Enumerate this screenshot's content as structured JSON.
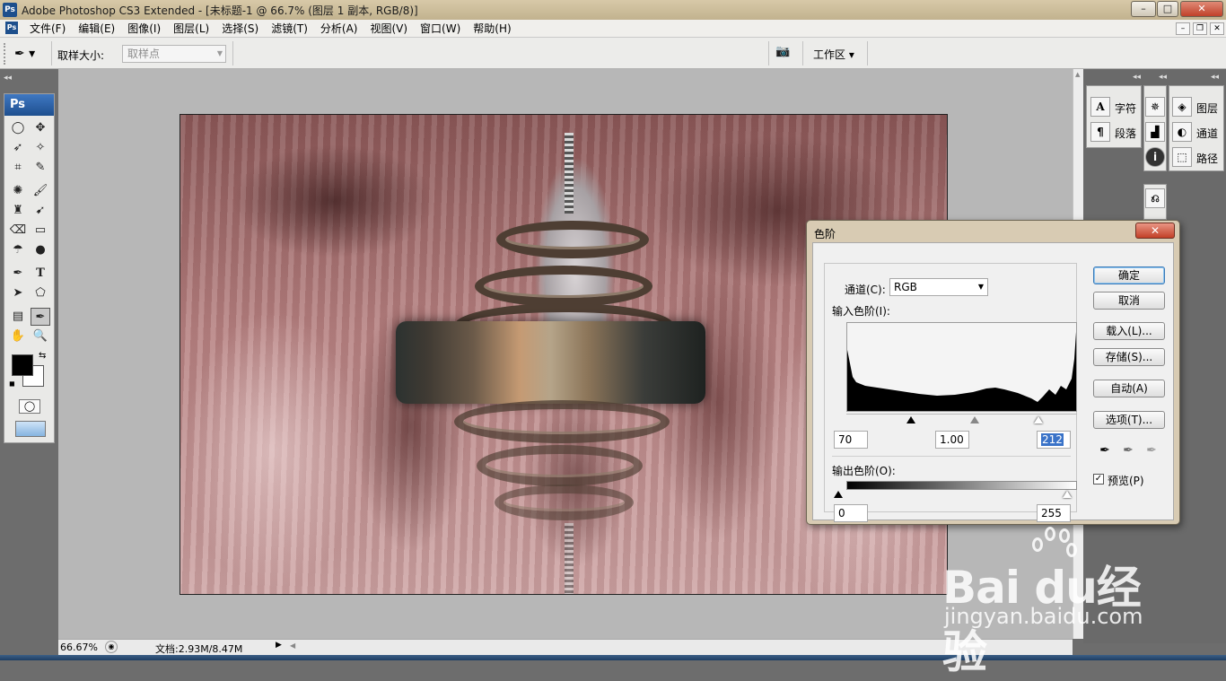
{
  "window": {
    "title": "Adobe Photoshop CS3 Extended - [未标题-1 @ 66.7% (图层 1 副本, RGB/8)]",
    "app_icon": "Ps",
    "minimize": "–",
    "maximize": "□",
    "close": "✕"
  },
  "menu": {
    "items": [
      "文件(F)",
      "编辑(E)",
      "图像(I)",
      "图层(L)",
      "选择(S)",
      "滤镜(T)",
      "分析(A)",
      "视图(V)",
      "窗口(W)",
      "帮助(H)"
    ],
    "doc_minimize": "–",
    "doc_restore": "❐",
    "doc_close": "✕"
  },
  "options": {
    "sample_size_label": "取样大小:",
    "sample_size_value": "取样点",
    "workspace_label": "工作区 ▾"
  },
  "toolbox": {
    "header": "Ps"
  },
  "right_panels": {
    "group1": [
      {
        "icon": "A",
        "label": "字符"
      },
      {
        "icon": "¶",
        "label": "段落"
      }
    ],
    "group3": [
      {
        "icon": "◈",
        "label": "图层"
      },
      {
        "icon": "◐",
        "label": "通道"
      },
      {
        "icon": "⬚",
        "label": "路径"
      }
    ]
  },
  "status": {
    "zoom": "66.67%",
    "doc_info": "文档:2.93M/8.47M"
  },
  "levels": {
    "title": "色阶",
    "close": "✕",
    "channel_label": "通道(C):",
    "channel_value": "RGB",
    "input_label": "输入色阶(I):",
    "input_black": "70",
    "input_gamma": "1.00",
    "input_white": "212",
    "output_label": "输出色阶(O):",
    "output_black": "0",
    "output_white": "255",
    "buttons": {
      "ok": "确定",
      "cancel": "取消",
      "load": "载入(L)...",
      "save": "存储(S)...",
      "auto": "自动(A)",
      "options": "选项(T)..."
    },
    "preview_label": "预览(P)",
    "preview_checked": true
  },
  "watermark": {
    "brand": "Bai du经验",
    "url": "jingyan.baidu.com"
  }
}
